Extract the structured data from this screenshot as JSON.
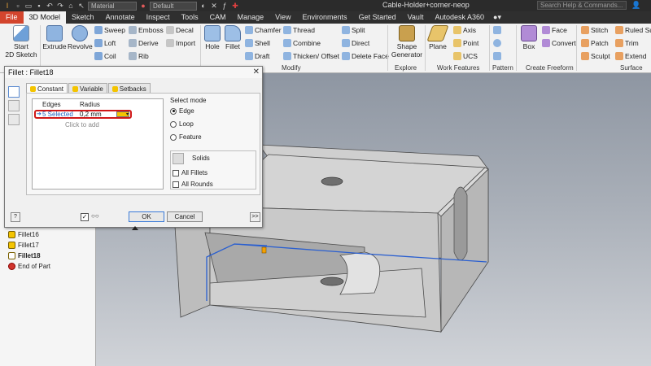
{
  "titlebar": {
    "material": "Material",
    "appearance": "Default",
    "doc_title": "Cable-Holder+corner-neop",
    "search_placeholder": "Search Help & Commands..."
  },
  "tabs": [
    "File",
    "3D Model",
    "Sketch",
    "Annotate",
    "Inspect",
    "Tools",
    "CAM",
    "Manage",
    "View",
    "Environments",
    "Get Started",
    "Vault",
    "Autodesk A360"
  ],
  "ribbon": {
    "start_sketch": "Start",
    "start_sketch2": "2D Sketch",
    "extrude": "Extrude",
    "revolve": "Revolve",
    "sweep": "Sweep",
    "loft": "Loft",
    "coil": "Coil",
    "emboss": "Emboss",
    "derive": "Derive",
    "rib": "Rib",
    "decal": "Decal",
    "import": "Import",
    "hole": "Hole",
    "fillet": "Fillet",
    "chamfer": "Chamfer",
    "shell": "Shell",
    "draft": "Draft",
    "thread": "Thread",
    "combine": "Combine",
    "thicken": "Thicken/ Offset",
    "split": "Split",
    "direct": "Direct",
    "delete_face": "Delete Face",
    "modify_label": "Modify",
    "shape_generator": "Shape",
    "shape_generator2": "Generator",
    "explore_label": "Explore",
    "plane": "Plane",
    "axis": "Axis",
    "point": "Point",
    "ucs": "UCS",
    "work_features_label": "Work Features",
    "pattern_label": "Pattern",
    "box": "Box",
    "face": "Face",
    "convert": "Convert",
    "freeform_label": "Create Freeform",
    "stitch": "Stitch",
    "patch": "Patch",
    "sculpt": "Sculpt",
    "ruled": "Ruled Sur",
    "trim": "Trim",
    "extend": "Extend",
    "surface_label": "Surface"
  },
  "browser": {
    "items": [
      {
        "label": "Fillet16",
        "kind": "fillet"
      },
      {
        "label": "Fillet17",
        "kind": "fillet"
      },
      {
        "label": "Fillet18",
        "kind": "fillet",
        "bold": true
      },
      {
        "label": "End of Part",
        "kind": "end"
      }
    ]
  },
  "dialog": {
    "title": "Fillet : Fillet18",
    "tabs": [
      "Constant",
      "Variable",
      "Setbacks"
    ],
    "col_edges": "Edges",
    "col_radius": "Radius",
    "edges_value": "5 Selected",
    "radius_value": "0,2 mm",
    "click_to_add": "Click to add",
    "select_mode": "Select mode",
    "modes": [
      "Edge",
      "Loop",
      "Feature"
    ],
    "solids": "Solids",
    "all_fillets": "All Fillets",
    "all_rounds": "All Rounds",
    "ok": "OK",
    "cancel": "Cancel",
    "more": ">>"
  },
  "colors": {
    "file_tab": "#d3452d",
    "highlight": "#d01818",
    "selection_blue": "#2060c0",
    "fillet_yellow": "#f4c400"
  }
}
